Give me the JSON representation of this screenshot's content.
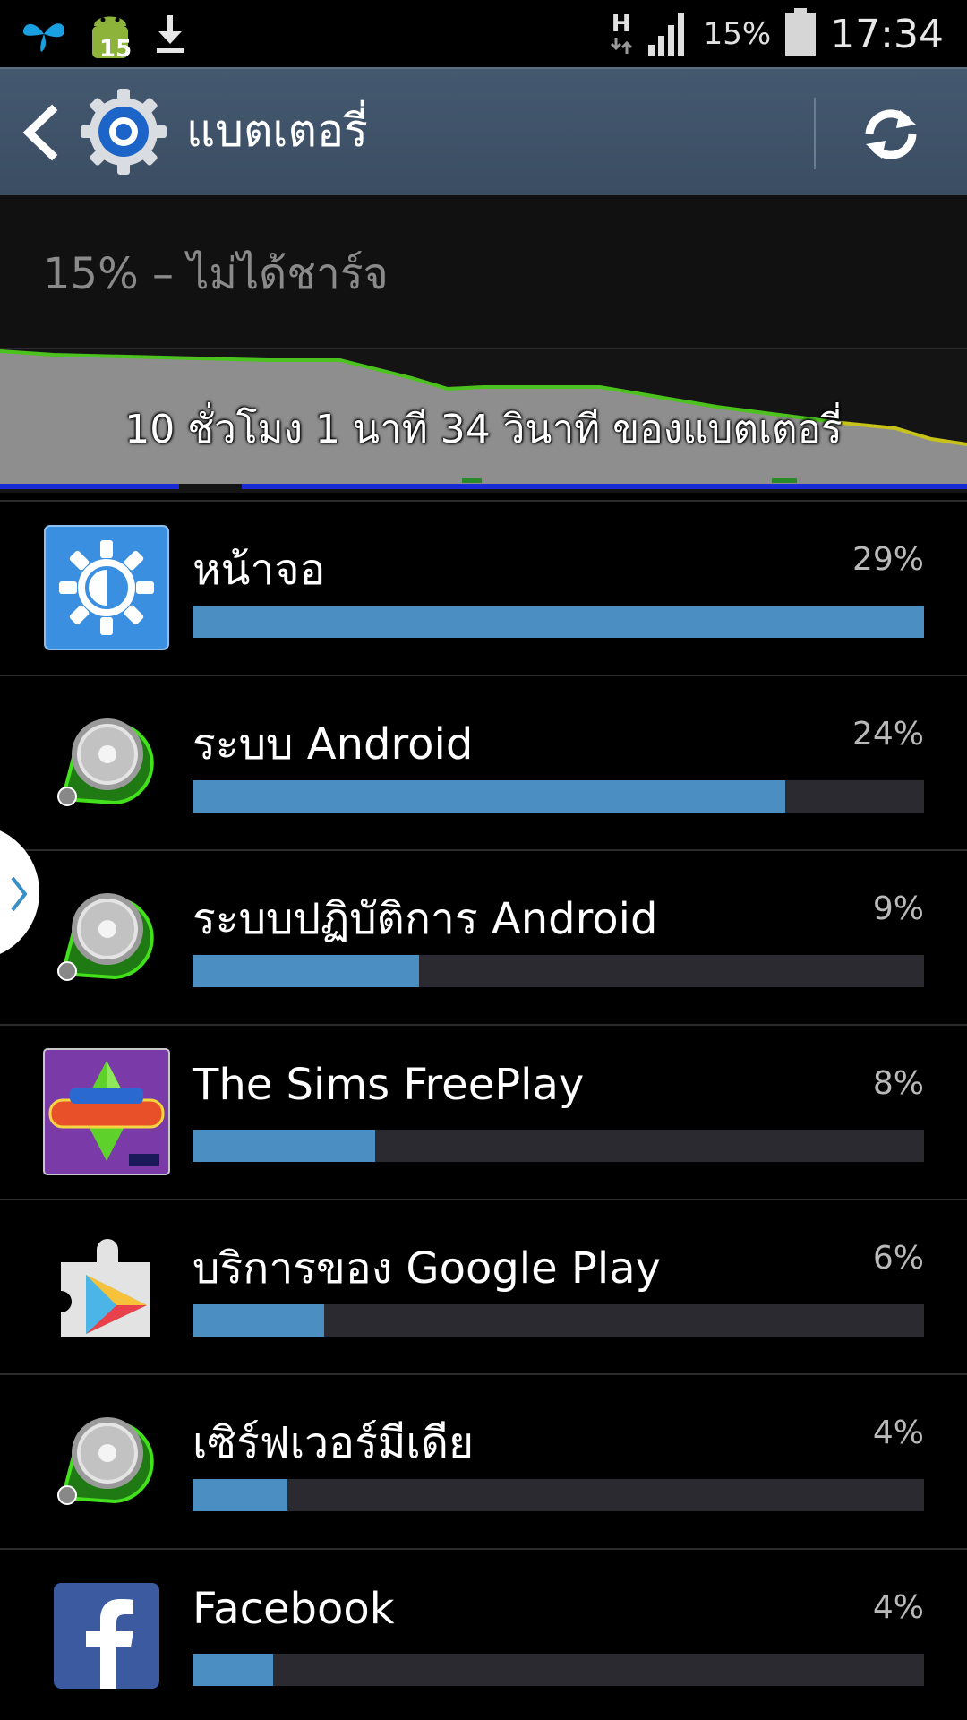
{
  "status_bar": {
    "notification_count": "15",
    "network_type": "H",
    "battery_percent": "15%",
    "time": "17:34"
  },
  "action_bar": {
    "title": "แบตเตอรี่",
    "back_icon": "back-arrow-icon",
    "app_icon": "settings-gear-icon",
    "refresh_icon": "refresh-icon"
  },
  "summary": {
    "status": "15% – ไม่ได้ชาร์จ"
  },
  "graph": {
    "duration_label": "10 ชั่วโมง 1 นาที 34 วินาที ของแบตเตอรี่",
    "colors": {
      "fill": "#8e8e8e",
      "line_good": "#4cc21e",
      "line_low": "#c6c21a",
      "signal": "#1a2bd6"
    }
  },
  "usage": [
    {
      "label": "หน้าจอ",
      "percent": "29%",
      "fraction": 1.0,
      "icon": "screen-brightness-icon"
    },
    {
      "label": "ระบบ Android",
      "percent": "24%",
      "fraction": 0.81,
      "icon": "android-system-icon"
    },
    {
      "label": "ระบบปฏิบัติการ Android",
      "percent": "9%",
      "fraction": 0.31,
      "icon": "android-os-icon"
    },
    {
      "label": "The Sims FreePlay",
      "percent": "8%",
      "fraction": 0.25,
      "icon": "sims-freeplay-icon"
    },
    {
      "label": "บริการของ Google Play",
      "percent": "6%",
      "fraction": 0.18,
      "icon": "google-play-services-icon"
    },
    {
      "label": "เซิร์ฟเวอร์มีเดีย",
      "percent": "4%",
      "fraction": 0.13,
      "icon": "media-server-icon"
    },
    {
      "label": "Facebook",
      "percent": "4%",
      "fraction": 0.11,
      "icon": "facebook-icon"
    }
  ],
  "accent_color": "#4a8ec2"
}
